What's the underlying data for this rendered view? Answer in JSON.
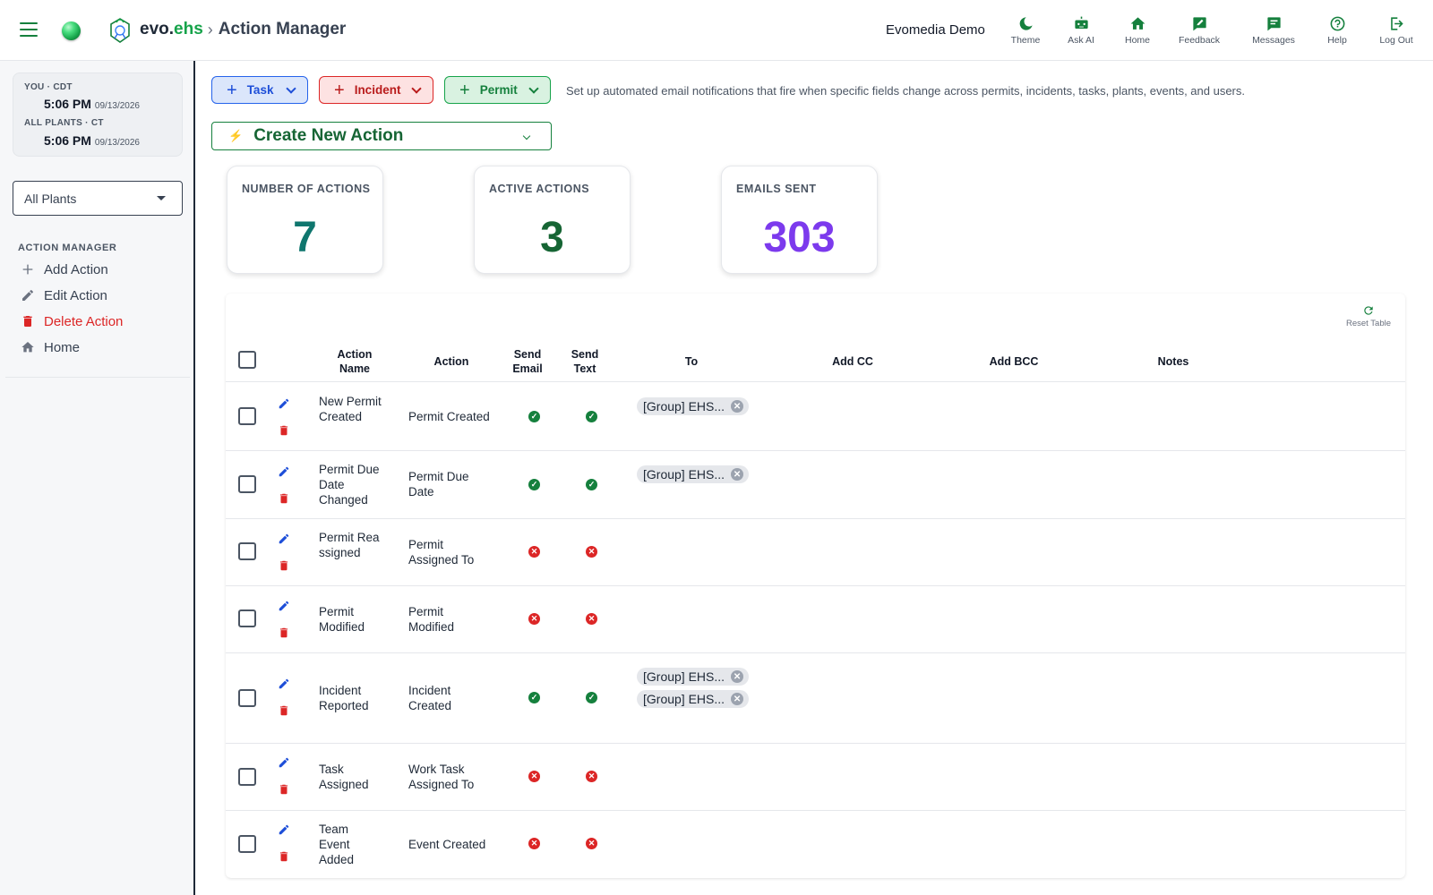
{
  "header": {
    "brand_evo": "evo",
    "brand_dot": ".",
    "brand_ehs": "ehs",
    "brand_sep": "›",
    "page_title": "Action Manager",
    "org_name": "Evomedia Demo",
    "nav": [
      {
        "label": "Theme",
        "icon": "moon-icon"
      },
      {
        "label": "Ask AI",
        "icon": "robot-icon"
      },
      {
        "label": "Home",
        "icon": "home-icon"
      },
      {
        "label": "Feedback",
        "icon": "feedback-icon"
      },
      {
        "label": "Messages",
        "icon": "message-icon"
      },
      {
        "label": "Help",
        "icon": "help-icon"
      },
      {
        "label": "Log Out",
        "icon": "logout-icon"
      }
    ]
  },
  "sidebar": {
    "clock": {
      "you_label": "YOU · CDT",
      "you_time": "5:06 PM",
      "you_date": "09/13/2026",
      "plants_label": "ALL PLANTS · CT",
      "plants_time": "5:06 PM",
      "plants_date": "09/13/2026"
    },
    "plant_select": "All Plants",
    "section_title": "ACTION MANAGER",
    "items": [
      {
        "label": "Add Action",
        "icon": "plus-icon"
      },
      {
        "label": "Edit Action",
        "icon": "pencil-icon"
      },
      {
        "label": "Delete Action",
        "icon": "trash-icon"
      },
      {
        "label": "Home",
        "icon": "home-icon"
      }
    ]
  },
  "toolbar": {
    "task_label": "Task",
    "incident_label": "Incident",
    "permit_label": "Permit",
    "intro": "Set up automated email notifications that fire when specific fields change across permits, incidents, tasks, plants, events, and users.",
    "create_label": "Create New Action"
  },
  "stats": {
    "actions_title": "NUMBER OF ACTIONS",
    "actions_value": "7",
    "active_title": "ACTIVE ACTIONS",
    "active_value": "3",
    "emails_title": "EMAILS SENT",
    "emails_value": "303"
  },
  "table": {
    "reset_label": "Reset Table",
    "columns": {
      "name_1": "Action",
      "name_2": "Name",
      "action": "Action",
      "email_1": "Send",
      "email_2": "Email",
      "text_1": "Send",
      "text_2": "Text",
      "to": "To",
      "cc": "Add CC",
      "bcc": "Add BCC",
      "notes": "Notes"
    },
    "rows": [
      {
        "name": "New Permit Created",
        "action": "Permit Created",
        "email": true,
        "text": true,
        "to": [
          "[Group] EHS..."
        ]
      },
      {
        "name": "Permit Due Date Changed",
        "action": "Permit Due Date",
        "email": true,
        "text": true,
        "to": [
          "[Group] EHS..."
        ]
      },
      {
        "name": "Permit Reassigned",
        "action": "Permit Assigned To",
        "email": false,
        "text": false,
        "to": []
      },
      {
        "name": "Permit Modified",
        "action": "Permit Modified",
        "email": false,
        "text": false,
        "to": []
      },
      {
        "name": "Incident Reported",
        "action": "Incident Created",
        "email": true,
        "text": true,
        "to": [
          "[Group] EHS...",
          "[Group] EHS..."
        ]
      },
      {
        "name": "Task Assigned",
        "action": "Work Task Assigned To",
        "email": false,
        "text": false,
        "to": []
      },
      {
        "name": "Team Event Added",
        "action": "Event Created",
        "email": false,
        "text": false,
        "to": []
      }
    ]
  },
  "colors": {
    "brand_green": "#16a34a",
    "actions_value": "#0f766e",
    "active_value": "#166534",
    "emails_value": "#7c3aed",
    "yes": "#15803d",
    "no": "#dc2626"
  }
}
